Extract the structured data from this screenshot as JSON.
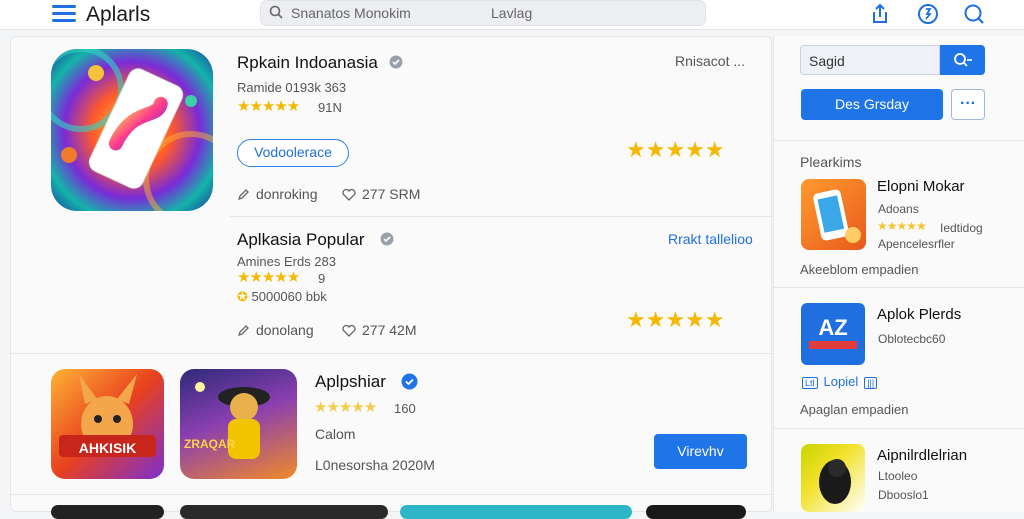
{
  "header": {
    "title": "Aplarls",
    "search_placeholder": "Snanatos Monokim",
    "search_hint": "Lavlag"
  },
  "featured": {
    "title": "Rpkain Indoanasia",
    "subtitle": "Ramide 0193k 363",
    "rating_count": "91N",
    "button": "Vodoolerace",
    "meta_left": "donroking",
    "meta_right": "277 SRM",
    "top_right": "Rnisacot ..."
  },
  "popular": {
    "title": "Aplkasia Popular",
    "subtitle": "Amines Erds 283",
    "rating_count": "9",
    "downloads": "5000060 bbk",
    "link": "Rrakt tallelioo",
    "meta_left": "donolang",
    "meta_right": "277 42M"
  },
  "listing": {
    "title": "Aplpshiar",
    "rating_count": "160",
    "category": "Calom",
    "date": "L0nesorsha 2020M",
    "button": "Virevhv",
    "tile1_text": "AHKISIK",
    "tile2_text": "ZRAQAR"
  },
  "sidebar": {
    "search_value": "Sagid",
    "primary_button": "Des Grsday",
    "more_button": "···",
    "section_label": "Plearkims",
    "items": [
      {
        "title": "Elopni Mokar",
        "line1": "Adoans",
        "line2": "Apencelesrfler",
        "rating_text": "Iedtidog",
        "footer": "Akeeblom empadien"
      },
      {
        "title": "Aplok Plerds",
        "line1": "Oblotecbc60",
        "badge": "Lopiel",
        "footer": "Apaglan empadien",
        "tile_text": "AZ"
      },
      {
        "title": "Aipnilrdlelrian",
        "line1": "Ltooleo",
        "line2": "Dbooslo1"
      }
    ]
  },
  "colors": {
    "accent": "#1f74e8",
    "star": "#f5b800"
  }
}
